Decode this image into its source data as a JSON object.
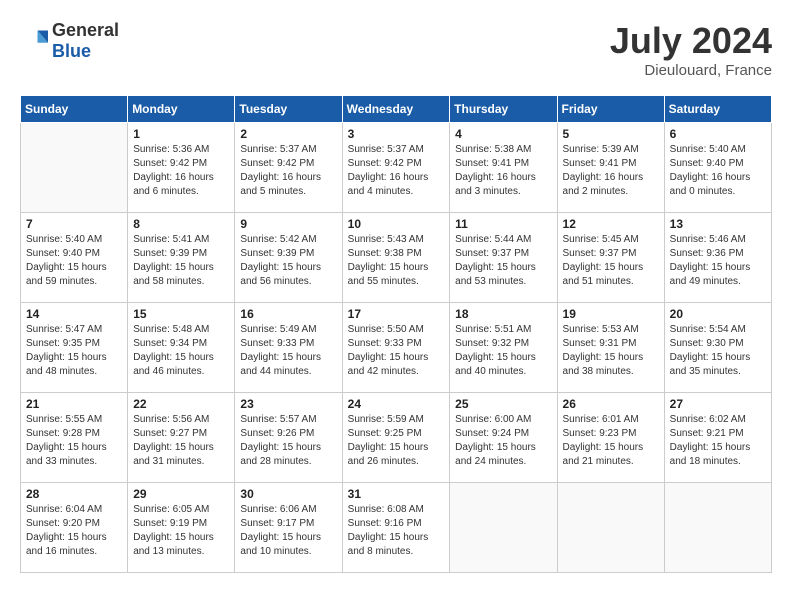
{
  "header": {
    "logo": {
      "general": "General",
      "blue": "Blue"
    },
    "title": "July 2024",
    "location": "Dieulouard, France"
  },
  "calendar": {
    "days_of_week": [
      "Sunday",
      "Monday",
      "Tuesday",
      "Wednesday",
      "Thursday",
      "Friday",
      "Saturday"
    ],
    "weeks": [
      [
        {
          "day": "",
          "info": ""
        },
        {
          "day": "1",
          "info": "Sunrise: 5:36 AM\nSunset: 9:42 PM\nDaylight: 16 hours\nand 6 minutes."
        },
        {
          "day": "2",
          "info": "Sunrise: 5:37 AM\nSunset: 9:42 PM\nDaylight: 16 hours\nand 5 minutes."
        },
        {
          "day": "3",
          "info": "Sunrise: 5:37 AM\nSunset: 9:42 PM\nDaylight: 16 hours\nand 4 minutes."
        },
        {
          "day": "4",
          "info": "Sunrise: 5:38 AM\nSunset: 9:41 PM\nDaylight: 16 hours\nand 3 minutes."
        },
        {
          "day": "5",
          "info": "Sunrise: 5:39 AM\nSunset: 9:41 PM\nDaylight: 16 hours\nand 2 minutes."
        },
        {
          "day": "6",
          "info": "Sunrise: 5:40 AM\nSunset: 9:40 PM\nDaylight: 16 hours\nand 0 minutes."
        }
      ],
      [
        {
          "day": "7",
          "info": "Sunrise: 5:40 AM\nSunset: 9:40 PM\nDaylight: 15 hours\nand 59 minutes."
        },
        {
          "day": "8",
          "info": "Sunrise: 5:41 AM\nSunset: 9:39 PM\nDaylight: 15 hours\nand 58 minutes."
        },
        {
          "day": "9",
          "info": "Sunrise: 5:42 AM\nSunset: 9:39 PM\nDaylight: 15 hours\nand 56 minutes."
        },
        {
          "day": "10",
          "info": "Sunrise: 5:43 AM\nSunset: 9:38 PM\nDaylight: 15 hours\nand 55 minutes."
        },
        {
          "day": "11",
          "info": "Sunrise: 5:44 AM\nSunset: 9:37 PM\nDaylight: 15 hours\nand 53 minutes."
        },
        {
          "day": "12",
          "info": "Sunrise: 5:45 AM\nSunset: 9:37 PM\nDaylight: 15 hours\nand 51 minutes."
        },
        {
          "day": "13",
          "info": "Sunrise: 5:46 AM\nSunset: 9:36 PM\nDaylight: 15 hours\nand 49 minutes."
        }
      ],
      [
        {
          "day": "14",
          "info": "Sunrise: 5:47 AM\nSunset: 9:35 PM\nDaylight: 15 hours\nand 48 minutes."
        },
        {
          "day": "15",
          "info": "Sunrise: 5:48 AM\nSunset: 9:34 PM\nDaylight: 15 hours\nand 46 minutes."
        },
        {
          "day": "16",
          "info": "Sunrise: 5:49 AM\nSunset: 9:33 PM\nDaylight: 15 hours\nand 44 minutes."
        },
        {
          "day": "17",
          "info": "Sunrise: 5:50 AM\nSunset: 9:33 PM\nDaylight: 15 hours\nand 42 minutes."
        },
        {
          "day": "18",
          "info": "Sunrise: 5:51 AM\nSunset: 9:32 PM\nDaylight: 15 hours\nand 40 minutes."
        },
        {
          "day": "19",
          "info": "Sunrise: 5:53 AM\nSunset: 9:31 PM\nDaylight: 15 hours\nand 38 minutes."
        },
        {
          "day": "20",
          "info": "Sunrise: 5:54 AM\nSunset: 9:30 PM\nDaylight: 15 hours\nand 35 minutes."
        }
      ],
      [
        {
          "day": "21",
          "info": "Sunrise: 5:55 AM\nSunset: 9:28 PM\nDaylight: 15 hours\nand 33 minutes."
        },
        {
          "day": "22",
          "info": "Sunrise: 5:56 AM\nSunset: 9:27 PM\nDaylight: 15 hours\nand 31 minutes."
        },
        {
          "day": "23",
          "info": "Sunrise: 5:57 AM\nSunset: 9:26 PM\nDaylight: 15 hours\nand 28 minutes."
        },
        {
          "day": "24",
          "info": "Sunrise: 5:59 AM\nSunset: 9:25 PM\nDaylight: 15 hours\nand 26 minutes."
        },
        {
          "day": "25",
          "info": "Sunrise: 6:00 AM\nSunset: 9:24 PM\nDaylight: 15 hours\nand 24 minutes."
        },
        {
          "day": "26",
          "info": "Sunrise: 6:01 AM\nSunset: 9:23 PM\nDaylight: 15 hours\nand 21 minutes."
        },
        {
          "day": "27",
          "info": "Sunrise: 6:02 AM\nSunset: 9:21 PM\nDaylight: 15 hours\nand 18 minutes."
        }
      ],
      [
        {
          "day": "28",
          "info": "Sunrise: 6:04 AM\nSunset: 9:20 PM\nDaylight: 15 hours\nand 16 minutes."
        },
        {
          "day": "29",
          "info": "Sunrise: 6:05 AM\nSunset: 9:19 PM\nDaylight: 15 hours\nand 13 minutes."
        },
        {
          "day": "30",
          "info": "Sunrise: 6:06 AM\nSunset: 9:17 PM\nDaylight: 15 hours\nand 10 minutes."
        },
        {
          "day": "31",
          "info": "Sunrise: 6:08 AM\nSunset: 9:16 PM\nDaylight: 15 hours\nand 8 minutes."
        },
        {
          "day": "",
          "info": ""
        },
        {
          "day": "",
          "info": ""
        },
        {
          "day": "",
          "info": ""
        }
      ]
    ]
  }
}
